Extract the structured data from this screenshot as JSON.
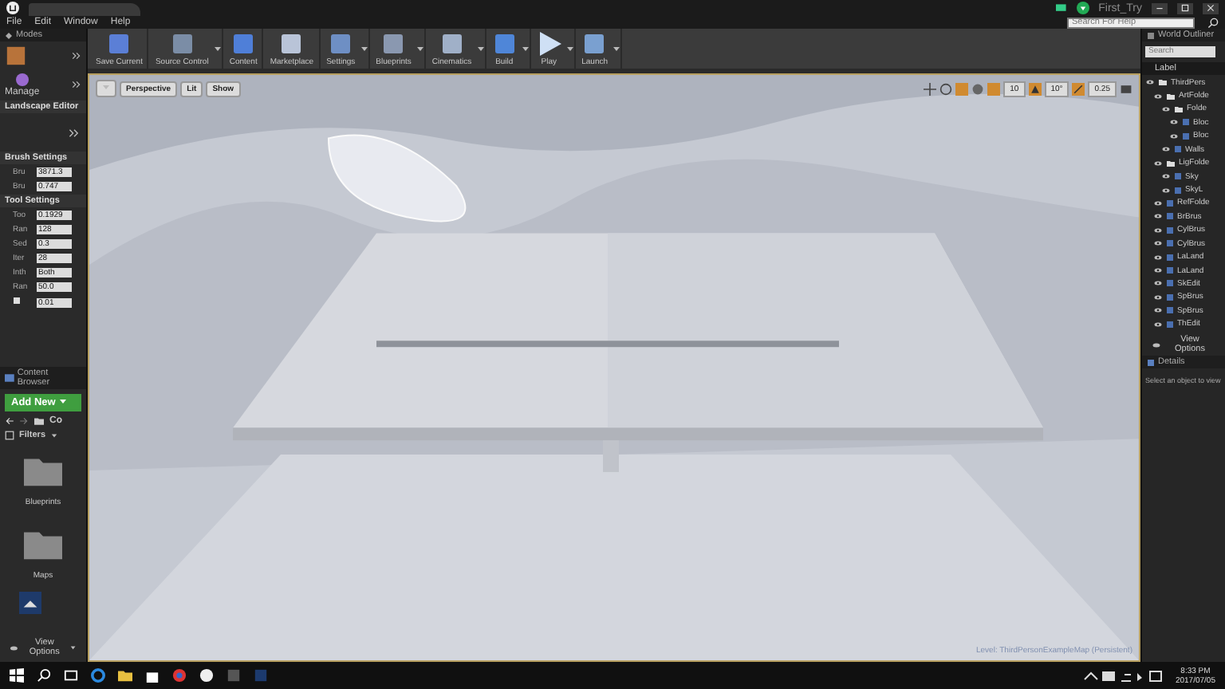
{
  "title_bar": {
    "project": "First_Try"
  },
  "menu": [
    "File",
    "Edit",
    "Window",
    "Help"
  ],
  "help_search": {
    "placeholder": "Search For Help"
  },
  "modes": {
    "title": "Modes",
    "manage": "Manage",
    "section": "Landscape Editor",
    "groups": [
      {
        "title": "Brush Settings",
        "rows": [
          {
            "label": "Bru",
            "value": "3871.3"
          },
          {
            "label": "Bru",
            "value": "0.747"
          }
        ]
      },
      {
        "title": "Tool Settings",
        "rows": [
          {
            "label": "Too",
            "value": "0.1929"
          },
          {
            "label": "Ran",
            "value": "128"
          },
          {
            "label": "Sed",
            "value": "0.3"
          },
          {
            "label": "Iter",
            "value": "28"
          },
          {
            "label": "Inth",
            "value": "Both"
          },
          {
            "label": "Ran",
            "value": "50.0"
          },
          {
            "label": "",
            "value": "0.01"
          }
        ]
      }
    ]
  },
  "content_browser": {
    "title": "Content Browser",
    "add_new": "Add New",
    "path": "Co",
    "filters": "Filters",
    "folders": [
      "Blueprints",
      "Maps"
    ],
    "view_options": "View Options"
  },
  "toolbar": [
    {
      "label": "Save Current",
      "menu": false
    },
    {
      "label": "Source Control",
      "menu": true
    },
    {
      "label": "Content",
      "menu": false
    },
    {
      "label": "Marketplace",
      "menu": false
    },
    {
      "label": "Settings",
      "menu": true
    },
    {
      "label": "Blueprints",
      "menu": true
    },
    {
      "label": "Cinematics",
      "menu": true
    },
    {
      "label": "Build",
      "menu": true
    },
    {
      "label": "Play",
      "menu": true
    },
    {
      "label": "Launch",
      "menu": true
    }
  ],
  "viewport": {
    "buttons": [
      "Perspective",
      "Lit",
      "Show"
    ],
    "grid_snap": "10",
    "rotation_snap": "10°",
    "scale_snap": "0.25",
    "level": "Level:  ThirdPersonExampleMap (Persistent)"
  },
  "outliner": {
    "title": "World Outliner",
    "search": {
      "placeholder": "Search"
    },
    "column": "Label",
    "items": [
      {
        "label": "ThirdPers",
        "children": [
          {
            "label": "ArtFolde",
            "children": [
              {
                "label": "Folde",
                "children": [
                  {
                    "label": "Bloc"
                  },
                  {
                    "label": "Bloc"
                  }
                ]
              },
              {
                "label": "Walls"
              }
            ]
          },
          {
            "label": "LigFolde",
            "children": [
              {
                "label": "Sky"
              },
              {
                "label": "SkyL"
              }
            ]
          },
          {
            "label": "RefFolde"
          },
          {
            "label": "BrBrus"
          },
          {
            "label": "CylBrus"
          },
          {
            "label": "CylBrus"
          },
          {
            "label": "LaLand"
          },
          {
            "label": "LaLand"
          },
          {
            "label": "SkEdit"
          },
          {
            "label": "SpBrus"
          },
          {
            "label": "SpBrus"
          },
          {
            "label": "ThEdit"
          }
        ]
      }
    ],
    "view_options": "View Options"
  },
  "details": {
    "title": "Details",
    "hint": "Select an object to view"
  },
  "taskbar": {
    "time": "8:33 PM",
    "date": "2017/07/05"
  }
}
